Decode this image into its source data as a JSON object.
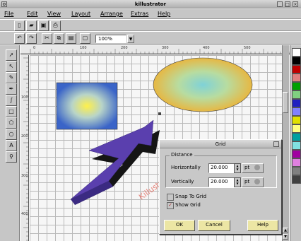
{
  "window": {
    "title": "killustrator"
  },
  "menu": [
    {
      "label": "File"
    },
    {
      "label": "Edit"
    },
    {
      "label": "View"
    },
    {
      "label": "Layout"
    },
    {
      "label": "Arrange"
    },
    {
      "label": "Extras"
    },
    {
      "label": "Help"
    }
  ],
  "toolbar": {
    "zoom": "100%"
  },
  "ruler": {
    "h_labels": [
      "0",
      "100",
      "200",
      "300",
      "400",
      "500"
    ],
    "v_labels": [
      "100",
      "200",
      "300",
      "400"
    ]
  },
  "canvas": {
    "text_object": "Killustrator is cool!!"
  },
  "dialog": {
    "title": "Grid",
    "distance_label": "Distance",
    "horizontal_label": "Horizontally",
    "horizontal_value": "20.000",
    "horizontal_unit": "pt",
    "vertical_label": "Vertically",
    "vertical_value": "20.000",
    "vertical_unit": "pt",
    "snap_label": "Snap To Grid",
    "show_label": "Show Grid",
    "snap_checked": false,
    "show_checked": true,
    "ok_label": "OK",
    "cancel_label": "Cancel",
    "help_label": "Help"
  },
  "palette": {
    "colors": [
      "#ffffff",
      "#000000",
      "#c00000",
      "#e08080",
      "#00a000",
      "#80d080",
      "#2020c0",
      "#8080ff",
      "#e0e000",
      "#ffff80",
      "#00a0a0",
      "#80e0e0",
      "#a000a0",
      "#e080e0",
      "#808080",
      "#404040"
    ]
  },
  "icons": [
    "arrow-icon",
    "node-icon",
    "pencil-icon",
    "pen-icon",
    "freehand-icon",
    "rectangle-icon",
    "polygon-icon",
    "ellipse-icon",
    "text-icon",
    "zoom-icon"
  ]
}
